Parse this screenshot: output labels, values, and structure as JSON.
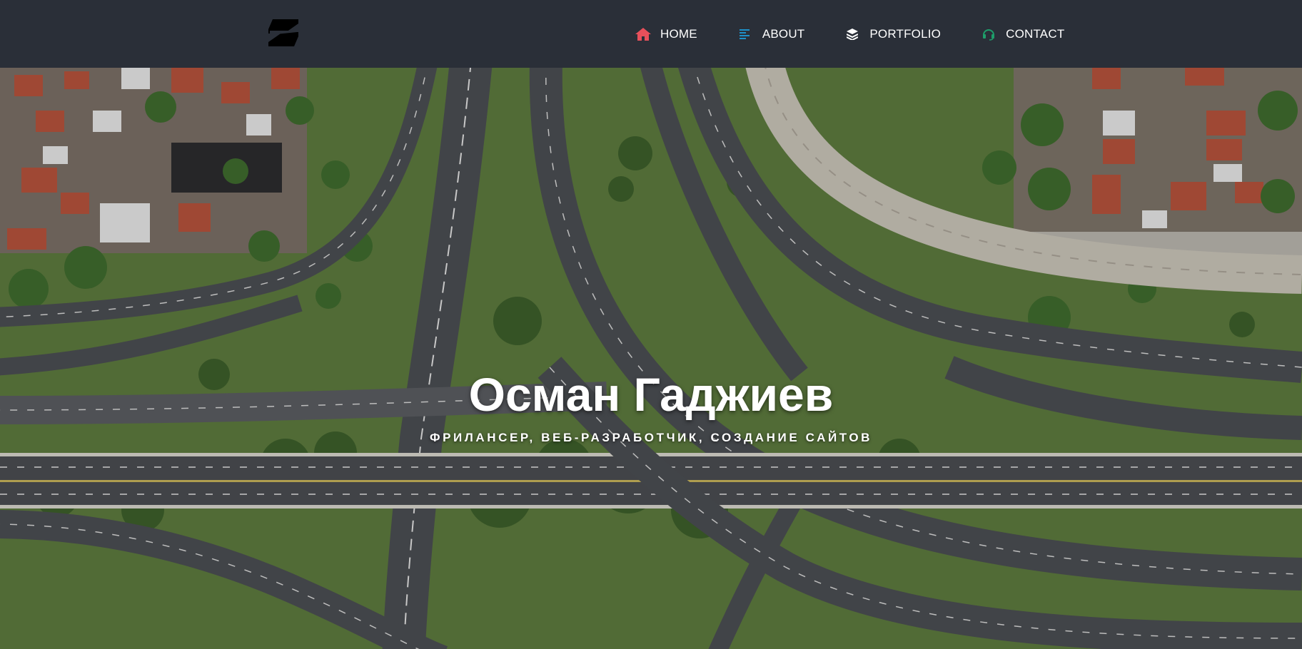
{
  "navbar": {
    "logo_icon": "logo-mark-icon",
    "items": [
      {
        "label": "HOME",
        "icon": "home-icon",
        "icon_color": "#e8505b"
      },
      {
        "label": "ABOUT",
        "icon": "align-left-icon",
        "icon_color": "#1e90c8"
      },
      {
        "label": "PORTFOLIO",
        "icon": "layers-icon",
        "icon_color": "#ffffff"
      },
      {
        "label": "CONTACT",
        "icon": "headset-icon",
        "icon_color": "#1e9e6a"
      }
    ]
  },
  "hero": {
    "title": "Осман Гаджиев",
    "subtitle": "ФРИЛАНСЕР, ВЕБ-РАЗРАБОТЧИК, СОЗДАНИЕ САЙТОВ",
    "background": "aerial-highway-interchange-photo"
  },
  "colors": {
    "navbar_bg": "#2a2f38",
    "text": "#ffffff"
  }
}
